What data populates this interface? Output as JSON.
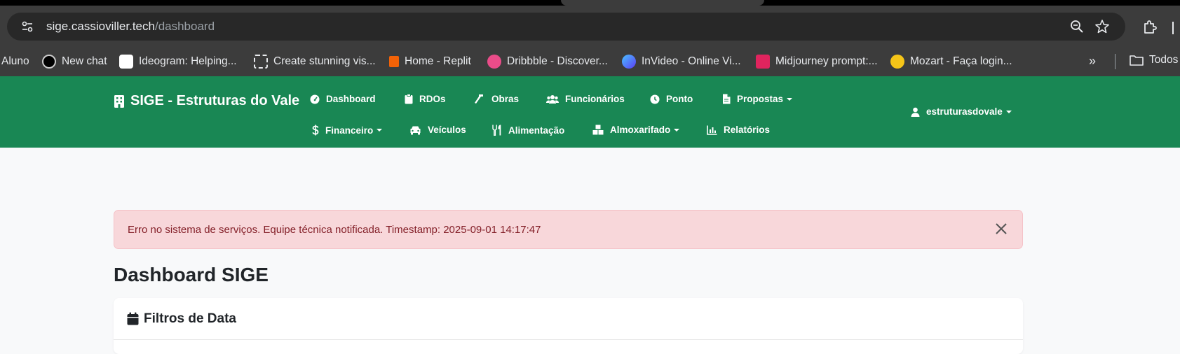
{
  "browser": {
    "url_host": "sige.cassioviller.tech",
    "url_path": "/dashboard",
    "bookmarks": [
      {
        "label": "Aluno",
        "icon": "none"
      },
      {
        "label": "New chat",
        "icon": "openai-icon"
      },
      {
        "label": "Ideogram: Helping...",
        "icon": "ideogram-icon"
      },
      {
        "label": "Create stunning vis...",
        "icon": "frame-icon"
      },
      {
        "label": "Home - Replit",
        "icon": "replit-icon"
      },
      {
        "label": "Dribbble - Discover...",
        "icon": "dribbble-icon"
      },
      {
        "label": "InVideo - Online Vi...",
        "icon": "invideo-icon"
      },
      {
        "label": "Midjourney prompt:...",
        "icon": "midjourney-icon"
      },
      {
        "label": "Mozart - Faça login...",
        "icon": "mozart-icon"
      }
    ],
    "more_label": "»",
    "folder_label": "Todos"
  },
  "navbar": {
    "brand": "SIGE - Estruturas do Vale",
    "items": [
      {
        "label": "Dashboard",
        "icon": "dashboard-icon"
      },
      {
        "label": "RDOs",
        "icon": "clipboard-icon"
      },
      {
        "label": "Obras",
        "icon": "hammer-icon"
      },
      {
        "label": "Funcionários",
        "icon": "users-icon"
      },
      {
        "label": "Ponto",
        "icon": "clock-icon"
      },
      {
        "label": "Propostas",
        "icon": "file-icon"
      },
      {
        "label": "Financeiro",
        "icon": "dollar-icon"
      },
      {
        "label": "Veículos",
        "icon": "car-icon"
      },
      {
        "label": "Alimentação",
        "icon": "utensils-icon"
      },
      {
        "label": "Almoxarifado",
        "icon": "boxes-icon"
      },
      {
        "label": "Relatórios",
        "icon": "chart-icon"
      }
    ],
    "user": "estruturasdovale"
  },
  "alert": {
    "message": "Erro no sistema de serviços. Equipe técnica notificada. Timestamp: 2025-09-01 14:17:47"
  },
  "page": {
    "title": "Dashboard SIGE",
    "filters_title": "Filtros de Data"
  },
  "colors": {
    "navbar": "#198754",
    "alert_bg": "#f8d7da",
    "alert_text": "#842029"
  }
}
